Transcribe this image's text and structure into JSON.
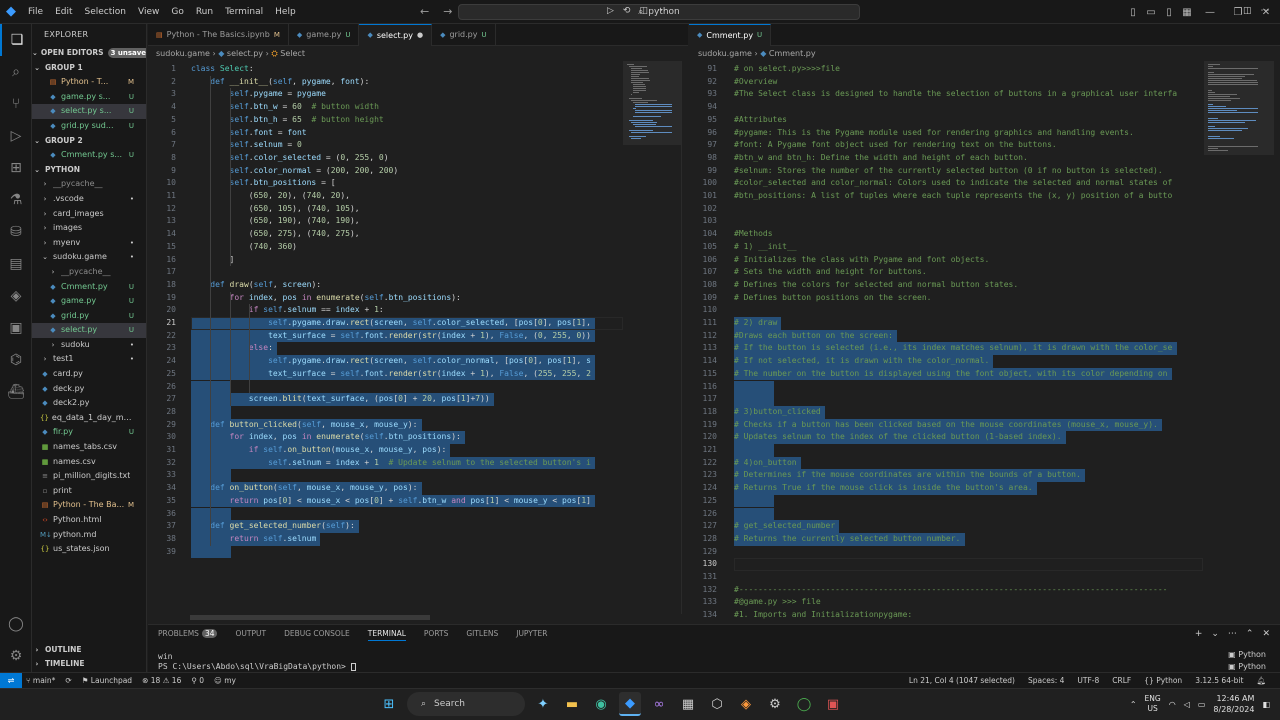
{
  "menu": [
    "File",
    "Edit",
    "Selection",
    "View",
    "Go",
    "Run",
    "Terminal",
    "Help"
  ],
  "search": {
    "text": "python"
  },
  "explorer": {
    "title": "EXPLORER",
    "open_editors": "OPEN EDITORS",
    "unsaved": "3 unsaved",
    "group1": "GROUP 1",
    "group1_items": [
      {
        "label": "Python - T...",
        "status": "M",
        "icon": "notebook"
      },
      {
        "label": "game.py  s...",
        "status": "U",
        "icon": "py"
      },
      {
        "label": "select.py  s...",
        "status": "U",
        "icon": "py"
      },
      {
        "label": "grid.py  sud...",
        "status": "U",
        "icon": "py"
      }
    ],
    "group2": "GROUP 2",
    "group2_items": [
      {
        "label": "Cmment.py  s...",
        "status": "U",
        "icon": "py"
      }
    ],
    "root": "PYTHON",
    "tree": [
      {
        "label": "__pycache__",
        "status": "",
        "icon": "folder",
        "depth": 1
      },
      {
        "label": ".vscode",
        "status": "•",
        "icon": "folder",
        "depth": 1
      },
      {
        "label": "card_images",
        "status": "",
        "icon": "folder",
        "depth": 1
      },
      {
        "label": "images",
        "status": "",
        "icon": "folder",
        "depth": 1
      },
      {
        "label": "myenv",
        "status": "•",
        "icon": "folder",
        "depth": 1
      },
      {
        "label": "sudoku.game",
        "status": "•",
        "icon": "folder-open",
        "depth": 1
      },
      {
        "label": "__pycache__",
        "status": "",
        "icon": "folder",
        "depth": 2
      },
      {
        "label": "Cmment.py",
        "status": "U",
        "icon": "py",
        "depth": 2
      },
      {
        "label": "game.py",
        "status": "U",
        "icon": "py",
        "depth": 2
      },
      {
        "label": "grid.py",
        "status": "U",
        "icon": "py",
        "depth": 2
      },
      {
        "label": "select.py",
        "status": "U",
        "icon": "py",
        "depth": 2
      },
      {
        "label": "sudoku",
        "status": "•",
        "icon": "folder",
        "depth": 2
      },
      {
        "label": "test1",
        "status": "•",
        "icon": "folder",
        "depth": 1
      },
      {
        "label": "card.py",
        "status": "",
        "icon": "py",
        "depth": 1
      },
      {
        "label": "deck.py",
        "status": "",
        "icon": "py",
        "depth": 1
      },
      {
        "label": "deck2.py",
        "status": "",
        "icon": "py",
        "depth": 1
      },
      {
        "label": "eq_data_1_day_m1.json",
        "status": "",
        "icon": "json",
        "depth": 1
      },
      {
        "label": "fir.py",
        "status": "U",
        "icon": "py",
        "depth": 1
      },
      {
        "label": "names_tabs.csv",
        "status": "",
        "icon": "csv",
        "depth": 1
      },
      {
        "label": "names.csv",
        "status": "",
        "icon": "csv",
        "depth": 1
      },
      {
        "label": "pi_million_digits.txt",
        "status": "",
        "icon": "txt",
        "depth": 1
      },
      {
        "label": "print",
        "status": "",
        "icon": "file",
        "depth": 1
      },
      {
        "label": "Python - The Ba...",
        "status": "M",
        "icon": "notebook",
        "depth": 1
      },
      {
        "label": "Python.html",
        "status": "",
        "icon": "html",
        "depth": 1
      },
      {
        "label": "python.md",
        "status": "",
        "icon": "md",
        "depth": 1
      },
      {
        "label": "us_states.json",
        "status": "",
        "icon": "json",
        "depth": 1
      }
    ],
    "outline": "OUTLINE",
    "timeline": "TIMELINE"
  },
  "left_tabs": [
    {
      "label": "Python - The Basics.ipynb",
      "flag": "M",
      "icon": "notebook",
      "active": false
    },
    {
      "label": "game.py",
      "flag": "U",
      "icon": "py",
      "active": false
    },
    {
      "label": "select.py",
      "flag": "●",
      "icon": "py",
      "active": true
    },
    {
      "label": "grid.py",
      "flag": "U",
      "icon": "py",
      "active": false
    }
  ],
  "left_breadcrumb": [
    "sudoku.game",
    "select.py",
    "Select"
  ],
  "right_tabs": [
    {
      "label": "Cmment.py",
      "flag": "U",
      "icon": "py",
      "active": true
    }
  ],
  "right_breadcrumb": [
    "sudoku.game",
    "Cmment.py"
  ],
  "left_code": [
    {
      "n": "1",
      "t": "class Select:"
    },
    {
      "n": "2",
      "t": "    def __init__(self, pygame, font):"
    },
    {
      "n": "3",
      "t": "        self.pygame = pygame"
    },
    {
      "n": "4",
      "t": "        self.btn_w = 60  # button width"
    },
    {
      "n": "5",
      "t": "        self.btn_h = 65  # button height"
    },
    {
      "n": "6",
      "t": "        self.font = font"
    },
    {
      "n": "7",
      "t": "        self.selnum = 0"
    },
    {
      "n": "8",
      "t": "        self.color_selected = (0, 255, 0)"
    },
    {
      "n": "9",
      "t": "        self.color_normal = (200, 200, 200)"
    },
    {
      "n": "10",
      "t": "        self.btn_positions = ["
    },
    {
      "n": "11",
      "t": "            (650, 20), (740, 20),"
    },
    {
      "n": "12",
      "t": "            (650, 105), (740, 105),"
    },
    {
      "n": "13",
      "t": "            (650, 190), (740, 190),"
    },
    {
      "n": "14",
      "t": "            (650, 275), (740, 275),"
    },
    {
      "n": "15",
      "t": "            (740, 360)"
    },
    {
      "n": "16",
      "t": "        ]"
    },
    {
      "n": "17",
      "t": ""
    },
    {
      "n": "18",
      "t": "    def draw(self, screen):"
    },
    {
      "n": "19",
      "t": "        for index, pos in enumerate(self.btn_positions):"
    },
    {
      "n": "20",
      "t": "            if self.selnum == index + 1:"
    },
    {
      "n": "21",
      "t": "                self.pygame.draw.rect(screen, self.color_selected, [pos[0], pos[1],"
    },
    {
      "n": "22",
      "t": "                text_surface = self.font.render(str(index + 1), False, (0, 255, 0))"
    },
    {
      "n": "23",
      "t": "            else:"
    },
    {
      "n": "24",
      "t": "                self.pygame.draw.rect(screen, self.color_normal, [pos[0], pos[1], s"
    },
    {
      "n": "25",
      "t": "                text_surface = self.font.render(str(index + 1), False, (255, 255, 2"
    },
    {
      "n": "26",
      "t": ""
    },
    {
      "n": "27",
      "t": "            screen.blit(text_surface, (pos[0] + 20, pos[1]+7))"
    },
    {
      "n": "28",
      "t": ""
    },
    {
      "n": "29",
      "t": "    def button_clicked(self, mouse_x, mouse_y):"
    },
    {
      "n": "30",
      "t": "        for index, pos in enumerate(self.btn_positions):"
    },
    {
      "n": "31",
      "t": "            if self.on_button(mouse_x, mouse_y, pos):"
    },
    {
      "n": "32",
      "t": "                self.selnum = index + 1  # Update selnum to the selected button's i"
    },
    {
      "n": "33",
      "t": ""
    },
    {
      "n": "34",
      "t": "    def on_button(self, mouse_x, mouse_y, pos):"
    },
    {
      "n": "35",
      "t": "        return pos[0] < mouse_x < pos[0] + self.btn_w and pos[1] < mouse_y < pos[1]"
    },
    {
      "n": "36",
      "t": ""
    },
    {
      "n": "37",
      "t": "    def get_selected_number(self):"
    },
    {
      "n": "38",
      "t": "        return self.selnum"
    },
    {
      "n": "39",
      "t": ""
    }
  ],
  "right_code": [
    {
      "n": "91",
      "t": "# on select.py>>>>file"
    },
    {
      "n": "92",
      "t": "#Overview"
    },
    {
      "n": "93",
      "t": "#The Select class is designed to handle the selection of buttons in a graphical user interfa"
    },
    {
      "n": "94",
      "t": ""
    },
    {
      "n": "95",
      "t": "#Attributes"
    },
    {
      "n": "96",
      "t": "#pygame: This is the Pygame module used for rendering graphics and handling events."
    },
    {
      "n": "97",
      "t": "#font: A Pygame font object used for rendering text on the buttons."
    },
    {
      "n": "98",
      "t": "#btn_w and btn_h: Define the width and height of each button."
    },
    {
      "n": "99",
      "t": "#selnum: Stores the number of the currently selected button (0 if no button is selected)."
    },
    {
      "n": "100",
      "t": "#color_selected and color_normal: Colors used to indicate the selected and normal states of"
    },
    {
      "n": "101",
      "t": "#btn_positions: A list of tuples where each tuple represents the (x, y) position of a butto"
    },
    {
      "n": "102",
      "t": ""
    },
    {
      "n": "103",
      "t": ""
    },
    {
      "n": "104",
      "t": "#Methods"
    },
    {
      "n": "105",
      "t": "# 1) __init__"
    },
    {
      "n": "106",
      "t": "# Initializes the class with Pygame and font objects."
    },
    {
      "n": "107",
      "t": "# Sets the width and height for buttons."
    },
    {
      "n": "108",
      "t": "# Defines the colors for selected and normal button states."
    },
    {
      "n": "109",
      "t": "# Defines button positions on the screen."
    },
    {
      "n": "110",
      "t": ""
    },
    {
      "n": "111",
      "t": "# 2) draw"
    },
    {
      "n": "112",
      "t": "#Draws each button on the screen:"
    },
    {
      "n": "113",
      "t": "# If the button is selected (i.e., its index matches selnum), it is drawn with the color_se"
    },
    {
      "n": "114",
      "t": "# If not selected, it is drawn with the color_normal."
    },
    {
      "n": "115",
      "t": "# The number on the button is displayed using the font object, with its color depending on"
    },
    {
      "n": "116",
      "t": ""
    },
    {
      "n": "117",
      "t": ""
    },
    {
      "n": "118",
      "t": "# 3)button_clicked"
    },
    {
      "n": "119",
      "t": "# Checks if a button has been clicked based on the mouse coordinates (mouse_x, mouse_y)."
    },
    {
      "n": "120",
      "t": "# Updates selnum to the index of the clicked button (1-based index)."
    },
    {
      "n": "121",
      "t": ""
    },
    {
      "n": "122",
      "t": "# 4)on_button"
    },
    {
      "n": "123",
      "t": "# Determines if the mouse coordinates are within the bounds of a button."
    },
    {
      "n": "124",
      "t": "# Returns True if the mouse click is inside the button's area."
    },
    {
      "n": "125",
      "t": ""
    },
    {
      "n": "126",
      "t": ""
    },
    {
      "n": "127",
      "t": "# get_selected_number"
    },
    {
      "n": "128",
      "t": "# Returns the currently selected button number."
    },
    {
      "n": "129",
      "t": ""
    },
    {
      "n": "130",
      "t": ""
    },
    {
      "n": "131",
      "t": ""
    },
    {
      "n": "132",
      "t": "#-----------------------------------------------------------------------------------------"
    },
    {
      "n": "133",
      "t": "#@game.py >>> file"
    },
    {
      "n": "134",
      "t": "#1. Imports and Initializationpygame:"
    }
  ],
  "panel": {
    "tabs": [
      "PROBLEMS",
      "OUTPUT",
      "DEBUG CONSOLE",
      "TERMINAL",
      "PORTS",
      "GITLENS",
      "JUPYTER"
    ],
    "active_tab": "TERMINAL",
    "problems_count": "34",
    "terminal_lines": [
      "win",
      "PS C:\\Users\\Abdo\\sql\\VraBigData\\python> "
    ],
    "terminal_list": [
      "Python",
      "Python"
    ]
  },
  "status": {
    "branch": "main*",
    "launchpad": "Launchpad",
    "errors": "18",
    "warnings": "16",
    "ports": "0",
    "user": "my",
    "position": "Ln 21, Col 4 (1047 selected)",
    "spaces": "Spaces: 4",
    "encoding": "UTF-8",
    "eol": "CRLF",
    "language": "Python",
    "interpreter": "3.12.5 64-bit"
  },
  "taskbar": {
    "search": "Search",
    "lang1": "ENG",
    "lang2": "US",
    "time": "12:46 AM",
    "date": "8/28/2024"
  },
  "colors": {
    "accent": "#0078d4",
    "selection": "#264f78",
    "modified": "#e2c08d",
    "untracked": "#73c991"
  }
}
